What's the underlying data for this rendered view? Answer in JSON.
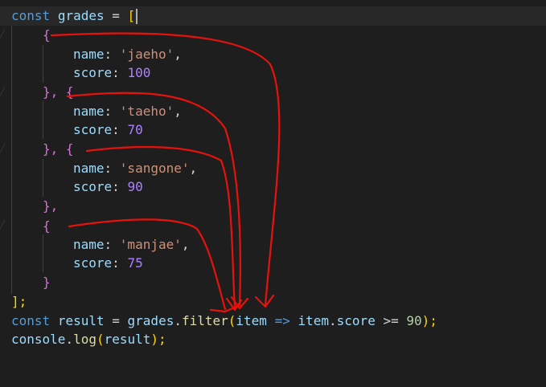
{
  "code": {
    "line1": {
      "kw": "const",
      "name": "grades",
      "op": "=",
      "open": "["
    },
    "obj_open": "{",
    "obj_sep": "}, {",
    "obj_close_comma": "},",
    "obj_close": "}",
    "array_close": "];",
    "name_key": "name",
    "score_key": "score",
    "items": [
      {
        "name": "'jaeho'",
        "score": "100"
      },
      {
        "name": "'taeho'",
        "score": "70"
      },
      {
        "name": "'sangone'",
        "score": "90"
      },
      {
        "name": "'manjae'",
        "score": "75"
      }
    ],
    "filter_line": {
      "kw": "const",
      "result": "result",
      "eq": "=",
      "grades": "grades",
      "dot": ".",
      "method": "filter",
      "paren_open": "(",
      "param": "item",
      "arrow": "=>",
      "item": "item",
      "prop": "score",
      "op": ">=",
      "value": "90",
      "end": ");"
    },
    "log_line": {
      "obj": "console",
      "method": "log",
      "paren_open": "(",
      "arg": "result",
      "end": ");"
    }
  },
  "annotation": {
    "color": "#e8120c"
  }
}
